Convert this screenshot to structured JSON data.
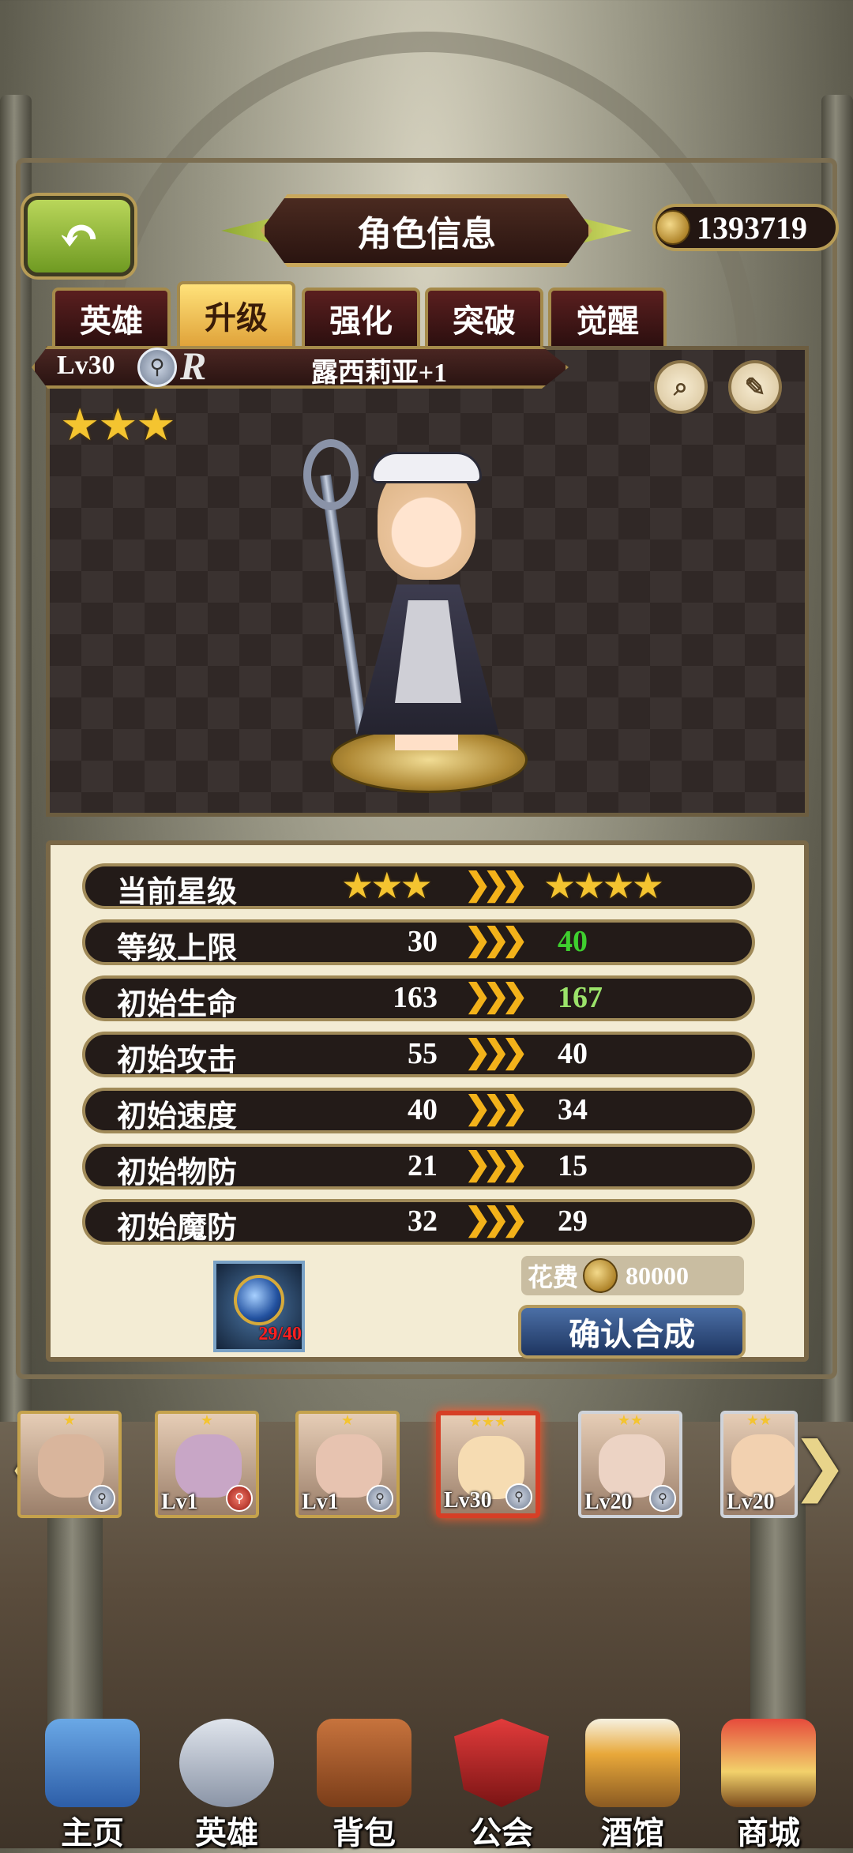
{
  "header": {
    "back_icon": "back-arrow-icon",
    "title": "角色信息",
    "gold": "1393719"
  },
  "tabs": [
    "英雄",
    "升级",
    "强化",
    "突破",
    "觉醒"
  ],
  "active_tab": "升级",
  "hero": {
    "level": "Lv30",
    "class_icon": "mage-staff-icon",
    "rarity": "R",
    "name": "露西莉亚+1",
    "stars": "★★★",
    "star_count": 3
  },
  "tools": {
    "zoom_icon": "magnifier-icon",
    "info_icon": "profile-note-icon"
  },
  "stats": {
    "current_star": {
      "label": "当前星级",
      "current": "★★★",
      "arrow": "❯❯❯",
      "next": "★★★★"
    },
    "rows": [
      {
        "label": "等级上限",
        "current": "30",
        "arrow": "❯❯❯",
        "next": "40"
      },
      {
        "label": "初始生命",
        "current": "163",
        "arrow": "❯❯❯",
        "next": "167"
      },
      {
        "label": "初始攻击",
        "current": "55",
        "arrow": "❯❯❯",
        "next": "40"
      },
      {
        "label": "初始速度",
        "current": "40",
        "arrow": "❯❯❯",
        "next": "34"
      },
      {
        "label": "初始物防",
        "current": "21",
        "arrow": "❯❯❯",
        "next": "15"
      },
      {
        "label": "初始魔防",
        "current": "32",
        "arrow": "❯❯❯",
        "next": "29"
      }
    ]
  },
  "material": {
    "count": "29/40"
  },
  "cost": {
    "label": "花费",
    "value": "80000"
  },
  "confirm_label": "确认合成",
  "carousel": [
    {
      "stars": "★",
      "level": "",
      "class": "mage"
    },
    {
      "stars": "★",
      "level": "Lv1",
      "class": "red-staff"
    },
    {
      "stars": "★",
      "level": "Lv1",
      "class": "mage"
    },
    {
      "stars": "★★★",
      "level": "Lv30",
      "class": "mage"
    },
    {
      "stars": "★★",
      "level": "Lv20",
      "class": "mage"
    },
    {
      "stars": "★★",
      "level": "Lv20",
      "class": ""
    }
  ],
  "nav": [
    "主页",
    "英雄",
    "背包",
    "公会",
    "酒馆",
    "商城"
  ],
  "colors": {
    "gold_star": "#f4c430",
    "green_increase": "#3fcf2f",
    "light_green_increase": "#9be36a",
    "arrow_orange": "#f3b21a"
  }
}
